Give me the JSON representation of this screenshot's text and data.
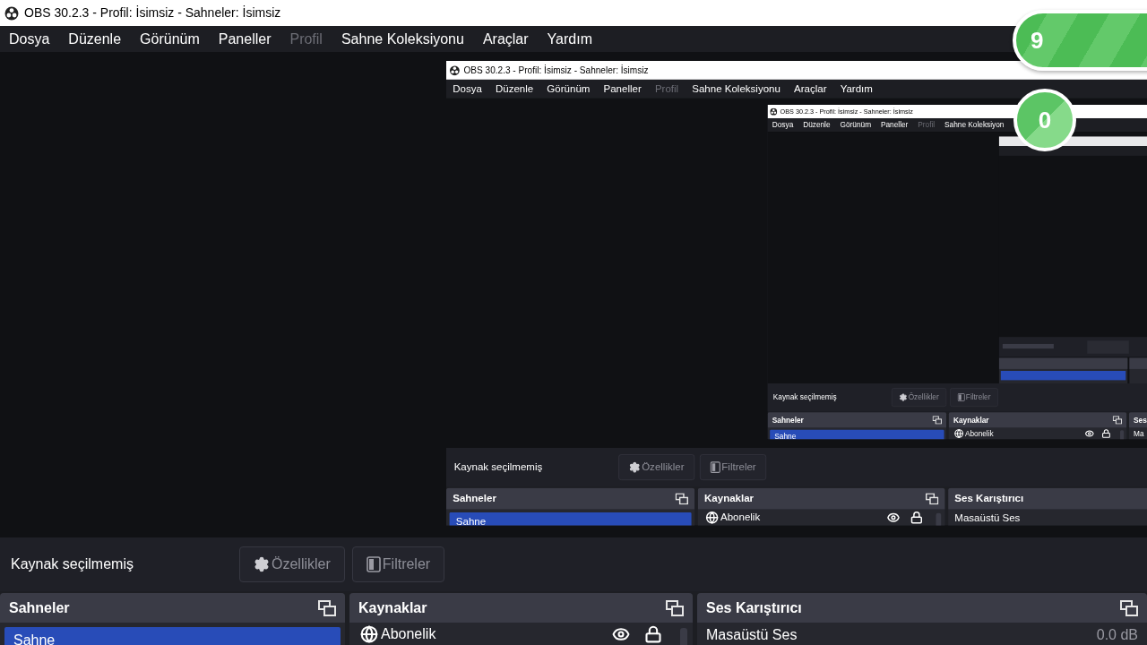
{
  "screens": [
    {
      "title": "OBS 30.2.3 - Profil: İsimsiz - Sahneler: İsimsiz",
      "menus": [
        {
          "label": "Dosya",
          "disabled": false
        },
        {
          "label": "Düzenle",
          "disabled": false
        },
        {
          "label": "Görünüm",
          "disabled": false
        },
        {
          "label": "Paneller",
          "disabled": false
        },
        {
          "label": "Profil",
          "disabled": true
        },
        {
          "label": "Sahne Koleksiyonu",
          "disabled": false
        },
        {
          "label": "Araçlar",
          "disabled": false
        },
        {
          "label": "Yardım",
          "disabled": false
        }
      ],
      "status": "Kaynak seçilmemiş",
      "buttons": [
        {
          "kind": "properties",
          "label": "Özellikler",
          "disabled": true
        },
        {
          "kind": "filters",
          "label": "Filtreler",
          "disabled": true
        }
      ],
      "docks": [
        {
          "kind": "scenes",
          "title": "Sahneler",
          "undock": true,
          "items": [
            {
              "label": "Sahne",
              "selected": true
            }
          ]
        },
        {
          "kind": "sources",
          "title": "Kaynaklar",
          "undock": true,
          "items": [
            {
              "label": "Abonelik",
              "visible": true,
              "locked": true
            }
          ]
        },
        {
          "kind": "mixer",
          "title": "Ses Karıştırıcı",
          "undock": true,
          "items": [
            {
              "label": "Masaüstü Ses",
              "reading": "0.0 dB"
            }
          ]
        }
      ]
    },
    {
      "title": "OBS 30.2.3 - Profil: İsimsiz - Sahneler: İsimsiz",
      "menus": [
        {
          "label": "Dosya",
          "disabled": false
        },
        {
          "label": "Düzenle",
          "disabled": false
        },
        {
          "label": "Görünüm",
          "disabled": false
        },
        {
          "label": "Paneller",
          "disabled": false
        },
        {
          "label": "Profil",
          "disabled": true
        },
        {
          "label": "Sahne Koleksiyonu",
          "disabled": false
        },
        {
          "label": "Araçlar",
          "disabled": false
        },
        {
          "label": "Yardım",
          "disabled": false
        }
      ],
      "status": "Kaynak seçilmemiş",
      "buttons": [
        {
          "kind": "properties",
          "label": "Özellikler",
          "disabled": true
        },
        {
          "kind": "filters",
          "label": "Filtreler",
          "disabled": true
        }
      ],
      "docks": [
        {
          "kind": "scenes",
          "title": "Sahneler",
          "undock": true,
          "items": [
            {
              "label": "Sahne",
              "selected": true
            }
          ]
        },
        {
          "kind": "sources",
          "title": "Kaynaklar",
          "undock": true,
          "items": [
            {
              "label": "Abonelik",
              "visible": true,
              "locked": true
            }
          ]
        },
        {
          "kind": "mixer",
          "title": "Ses Karıştırıcı",
          "items": [
            {
              "label": "Masaüstü Ses"
            }
          ]
        }
      ]
    },
    {
      "title": "OBS 30.2.3 - Profil: İsimsiz - Sahneler: İsimsiz",
      "menus": [
        {
          "label": "Dosya",
          "disabled": false
        },
        {
          "label": "Düzenle",
          "disabled": false
        },
        {
          "label": "Görünüm",
          "disabled": false
        },
        {
          "label": "Paneller",
          "disabled": false
        },
        {
          "label": "Profil",
          "disabled": true
        },
        {
          "label": "Sahne Koleksiyon",
          "disabled": false
        }
      ],
      "preview": {
        "kind": "picture"
      },
      "status": "Kaynak seçilmemiş",
      "buttons": [
        {
          "kind": "properties",
          "label": "Özellikler",
          "disabled": true
        },
        {
          "kind": "filters",
          "label": "Filtreler",
          "disabled": true
        }
      ],
      "docks": [
        {
          "kind": "scenes",
          "title": "Sahneler",
          "undock": true,
          "items": [
            {
              "label": "Sahne",
              "selected": true
            }
          ]
        },
        {
          "kind": "sources",
          "title": "Kaynaklar",
          "undock": true,
          "items": [
            {
              "label": "Abonelik",
              "visible": true,
              "locked": true
            }
          ]
        },
        {
          "kind": "mixer",
          "title": "Ses",
          "items": [
            {
              "label": "Ma"
            }
          ]
        }
      ]
    }
  ],
  "overlays": [
    {
      "kind": "bar",
      "label": "9"
    },
    {
      "kind": "circle",
      "label": "0"
    }
  ]
}
